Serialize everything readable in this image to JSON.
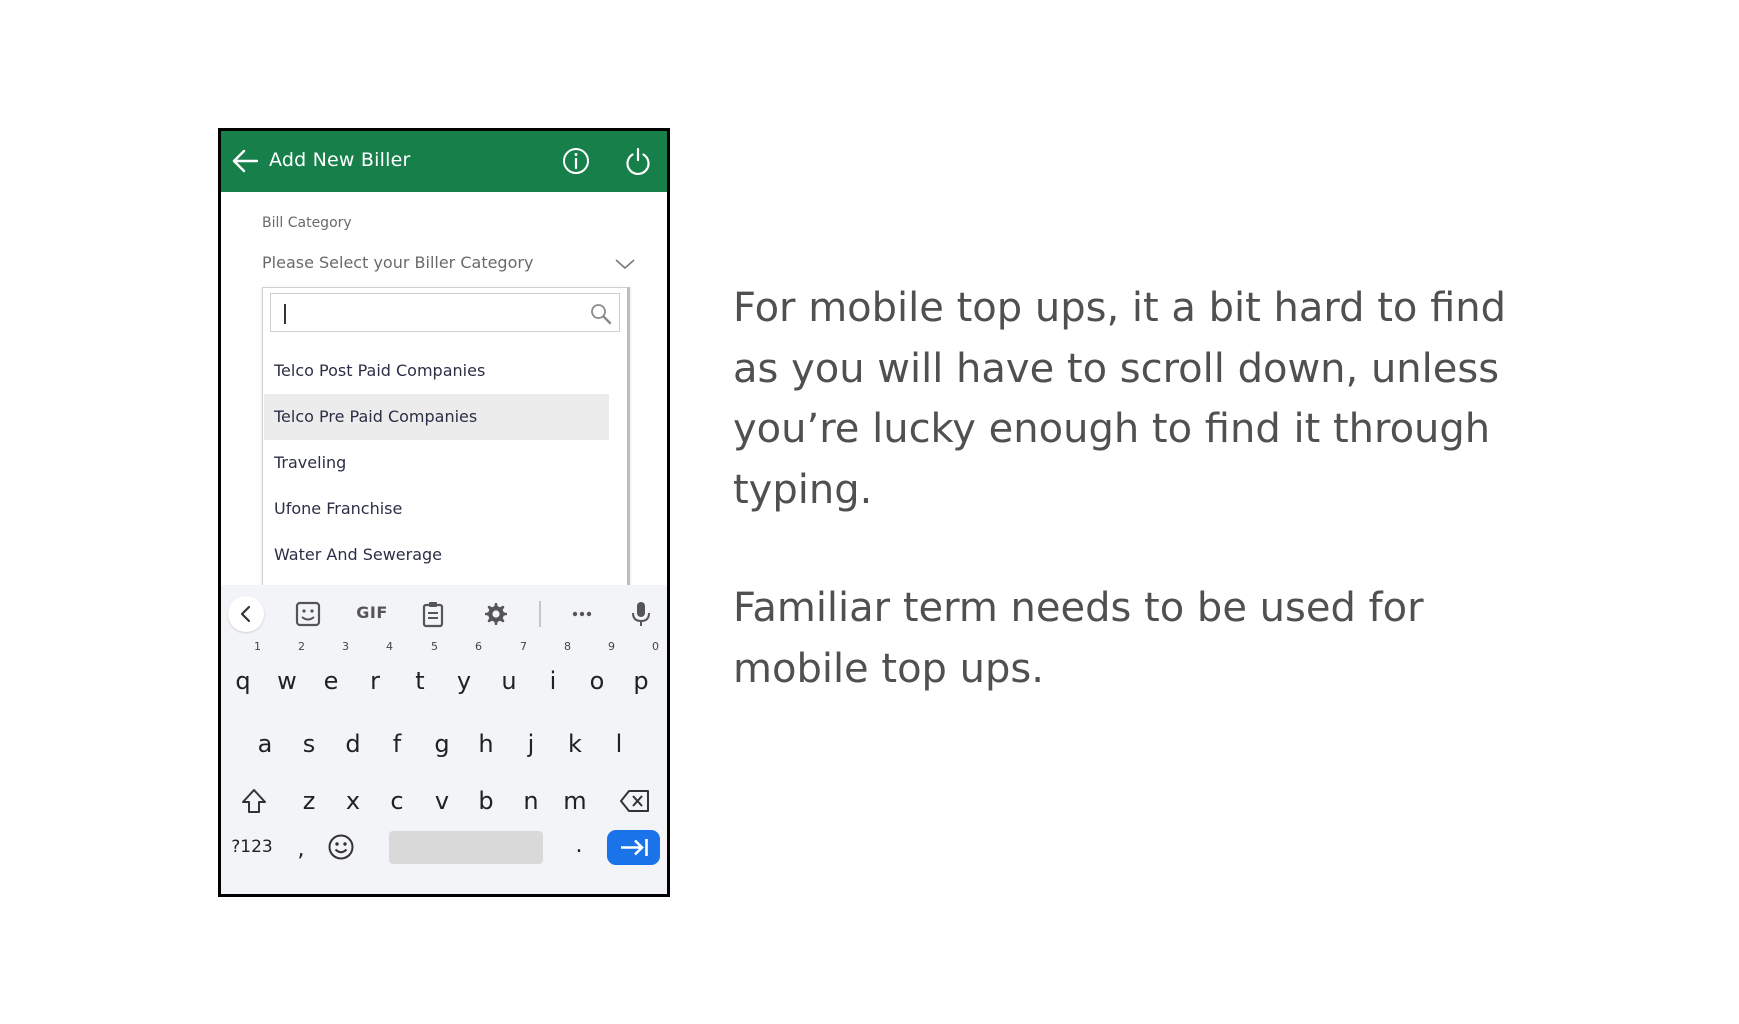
{
  "app": {
    "title": "Add New Biller",
    "accent_color": "#17804a",
    "icons": [
      "back-arrow-icon",
      "info-icon",
      "power-icon"
    ]
  },
  "form": {
    "field_label": "Bill Category",
    "select_placeholder": "Please Select your Biller Category",
    "search_value": "",
    "options": [
      {
        "label": "Telco Post Paid Companies",
        "selected": false
      },
      {
        "label": "Telco Pre Paid Companies",
        "selected": true
      },
      {
        "label": "Traveling",
        "selected": false
      },
      {
        "label": "Ufone Franchise",
        "selected": false
      },
      {
        "label": "Water And Sewerage",
        "selected": false
      }
    ]
  },
  "keyboard": {
    "toolbar_gif": "GIF",
    "row1": [
      "q",
      "w",
      "e",
      "r",
      "t",
      "y",
      "u",
      "i",
      "o",
      "p"
    ],
    "row1_hints": [
      "1",
      "2",
      "3",
      "4",
      "5",
      "6",
      "7",
      "8",
      "9",
      "0"
    ],
    "row2": [
      "a",
      "s",
      "d",
      "f",
      "g",
      "h",
      "j",
      "k",
      "l"
    ],
    "row3": [
      "z",
      "x",
      "c",
      "v",
      "b",
      "n",
      "m"
    ],
    "symbols_key": "?123",
    "comma_key": ",",
    "period_key": ".",
    "enter_color": "#1a73e8"
  },
  "annotations": {
    "note1": "For mobile top ups, it a bit hard to find as you will have to scroll down, unless you’re lucky enough to find it through typing.",
    "note2": "Familiar term needs to be used for mobile top ups."
  }
}
